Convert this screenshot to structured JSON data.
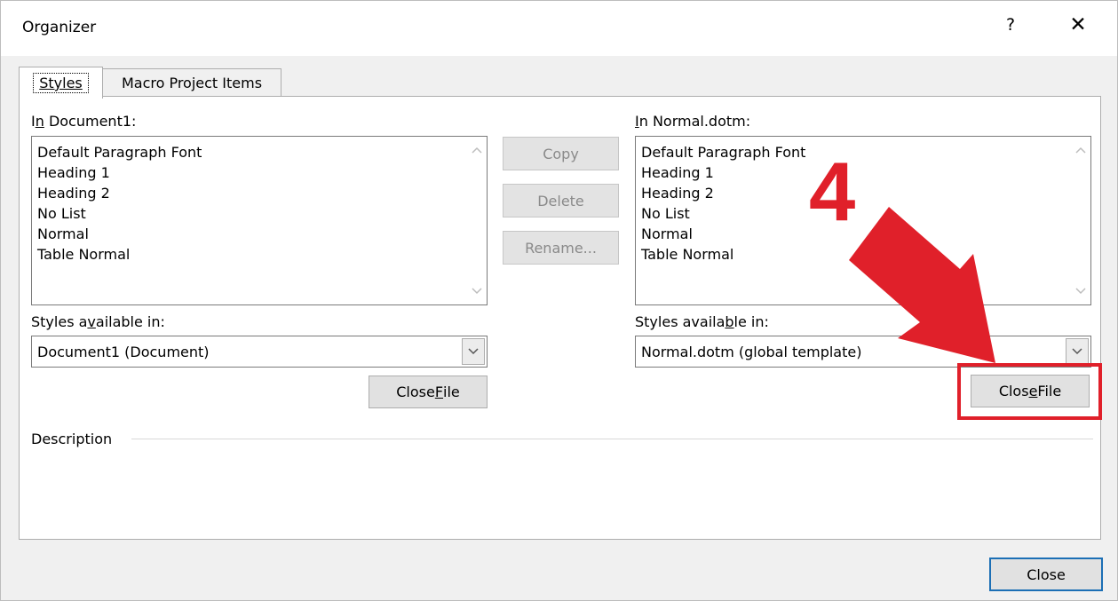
{
  "dialog": {
    "title": "Organizer",
    "help_label": "?",
    "close_glyph": "✕"
  },
  "tabs": [
    {
      "label": "Styles",
      "active": true
    },
    {
      "label": "Macro Project Items",
      "active": false
    }
  ],
  "left": {
    "label_prefix": "I",
    "label_underlined": "n",
    "label_suffix": " Document1:",
    "items": [
      "Default Paragraph Font",
      "Heading 1",
      "Heading 2",
      "No List",
      "Normal",
      "Table Normal"
    ],
    "available_prefix": "Styles a",
    "available_underlined": "v",
    "available_suffix": "ailable in:",
    "combo_value": "Document1 (Document)",
    "close_file_prefix": "Close ",
    "close_file_underlined": "F",
    "close_file_suffix": "ile"
  },
  "right": {
    "label_prefix": "",
    "label_underlined": "I",
    "label_suffix": "n Normal.dotm:",
    "items": [
      "Default Paragraph Font",
      "Heading 1",
      "Heading 2",
      "No List",
      "Normal",
      "Table Normal"
    ],
    "available_prefix": "Styles availa",
    "available_underlined": "b",
    "available_suffix": "le in:",
    "combo_value": "Normal.dotm (global template)",
    "close_file_prefix": "Clos",
    "close_file_underlined": "e",
    "close_file_suffix": " File"
  },
  "middle_buttons": {
    "copy": "Copy",
    "delete": "Delete",
    "rename": "Rename..."
  },
  "description_label": "Description",
  "close_button": "Close",
  "annotation": {
    "number": "4",
    "color": "#e0202a"
  }
}
